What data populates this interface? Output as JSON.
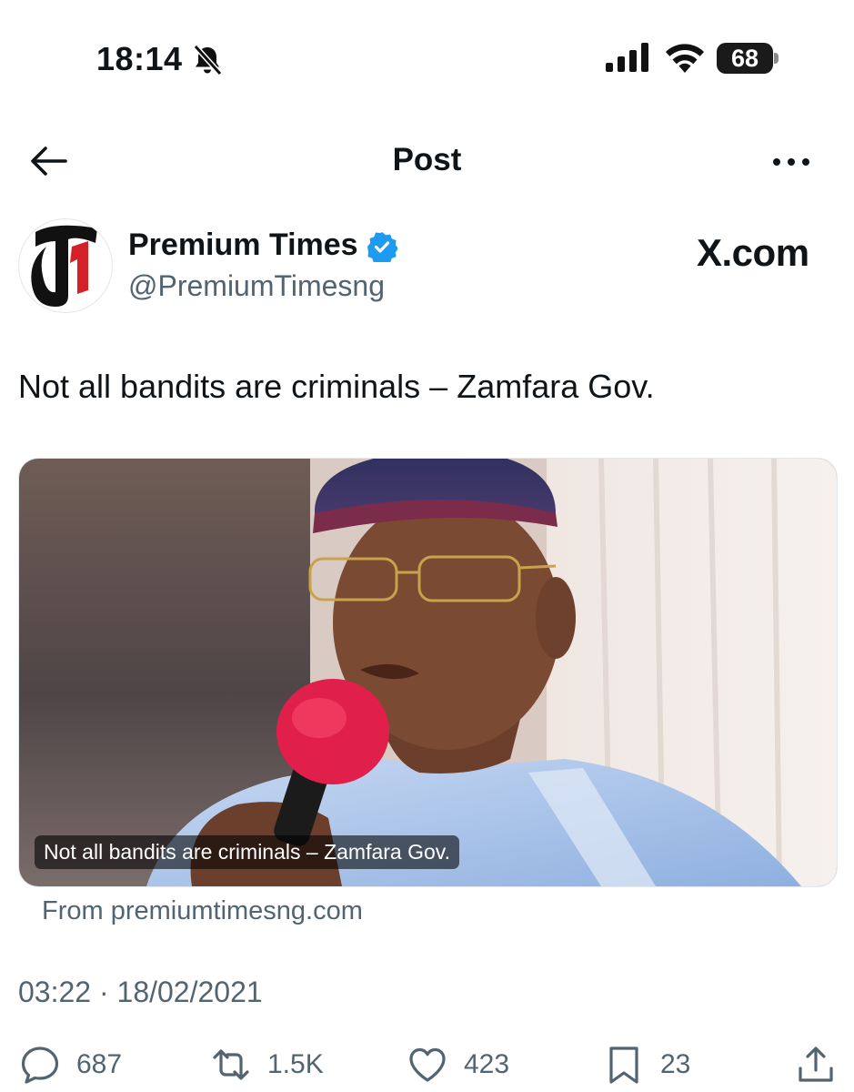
{
  "status_bar": {
    "time": "18:14",
    "battery": "68"
  },
  "nav": {
    "title": "Post"
  },
  "author": {
    "name": "Premium Times",
    "handle": "@PremiumTimesng",
    "verified": true
  },
  "watermark": "X.com",
  "tweet": {
    "text": "Not all bandits are criminals – Zamfara Gov.",
    "card_caption": "Not all bandits are criminals – Zamfara Gov.",
    "card_source": "From premiumtimesng.com",
    "timestamp": "03:22 · 18/02/2021"
  },
  "actions": {
    "replies": "687",
    "retweets": "1.5K",
    "likes": "423",
    "bookmarks": "23"
  },
  "colors": {
    "verified_blue": "#1d9bf0",
    "secondary_text": "#536471",
    "logo_red": "#d42027"
  },
  "icons": [
    "bell-muted-icon",
    "signal-icon",
    "wifi-icon",
    "battery-icon",
    "back-arrow-icon",
    "more-icon",
    "verified-badge-icon",
    "reply-icon",
    "retweet-icon",
    "like-icon",
    "bookmark-icon",
    "share-icon"
  ]
}
